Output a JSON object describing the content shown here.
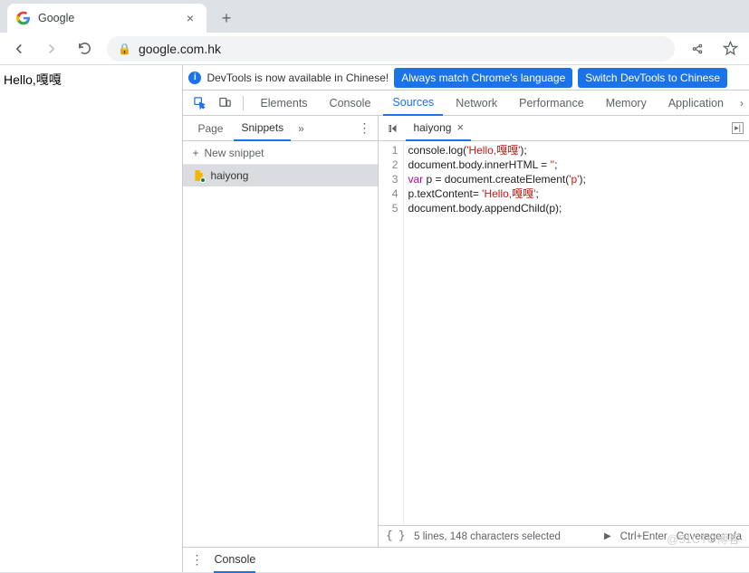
{
  "browser": {
    "tab_title": "Google",
    "url": "google.com.hk"
  },
  "page": {
    "body_text": "Hello,嘎嘎"
  },
  "devtools": {
    "banner": {
      "message": "DevTools is now available in Chinese!",
      "btn1": "Always match Chrome's language",
      "btn2": "Switch DevTools to Chinese"
    },
    "tabs": [
      "Elements",
      "Console",
      "Sources",
      "Network",
      "Performance",
      "Memory",
      "Application"
    ],
    "active_tab": "Sources",
    "navigator": {
      "tabs": [
        "Page",
        "Snippets"
      ],
      "active": "Snippets",
      "new_snippet_label": "New snippet",
      "snippet_name": "haiyong"
    },
    "editor": {
      "open_file": "haiyong",
      "lines": [
        {
          "n": 1,
          "pre": "console.log(",
          "str": "'Hello,嘎嘎'",
          "post": ");"
        },
        {
          "n": 2,
          "pre": "document.body.innerHTML = ",
          "str": "''",
          "post": ";"
        },
        {
          "n": 3,
          "kw": "var",
          "mid": " p = document.createElement(",
          "str": "'p'",
          "post": ");"
        },
        {
          "n": 4,
          "pre": "p.textContent= ",
          "str": "'Hello,嘎嘎'",
          "post": ";"
        },
        {
          "n": 5,
          "pre": "document.body.appendChild(p);",
          "str": "",
          "post": ""
        }
      ]
    },
    "status": {
      "selection": "5 lines, 148 characters selected",
      "run_hint": "Ctrl+Enter",
      "coverage": "Coverage: n/a"
    },
    "drawer_tab": "Console"
  },
  "watermark": "@51CTO博客"
}
